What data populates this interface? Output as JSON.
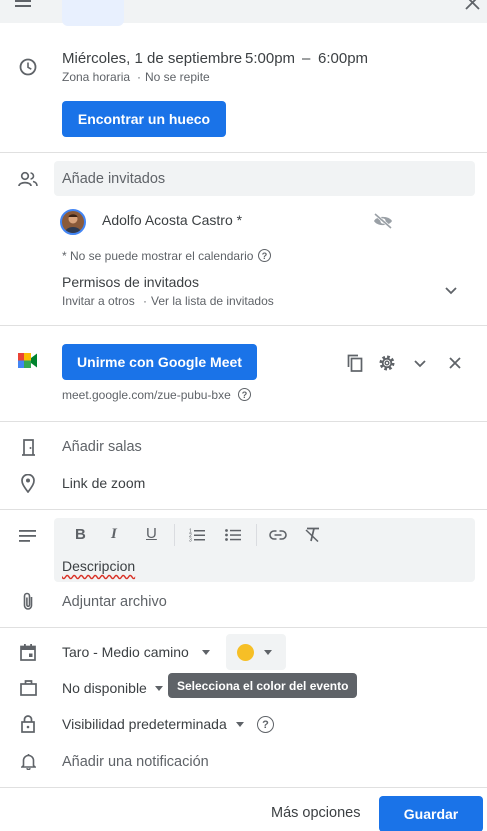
{
  "datetime": {
    "date": "Miércoles, 1 de septiembre",
    "start": "5:00pm",
    "dash": "–",
    "end": "6:00pm",
    "timezone": "Zona horaria",
    "repeat": "No se repite"
  },
  "find_slot_button": "Encontrar un hueco",
  "guests": {
    "input_placeholder": "Añade invitados",
    "guest_name": "Adolfo Acosta Castro *",
    "calendar_note": "* No se puede mostrar el calendario",
    "permissions_title": "Permisos de invitados",
    "permissions_detail_1": "Invitar a otros",
    "permissions_detail_2": "Ver la lista de invitados"
  },
  "meet": {
    "join_button": "Unirme con Google Meet",
    "link": "meet.google.com/zue-pubu-bxe"
  },
  "rooms_label": "Añadir salas",
  "location_value": "Link de zoom",
  "description": {
    "text": "Descripcion"
  },
  "attach_label": "Adjuntar archivo",
  "calendar": {
    "name": "Taro - Medio camino",
    "color": "#f6bf26",
    "color_tooltip": "Selecciona el color del evento"
  },
  "availability": "No disponible",
  "visibility": "Visibilidad predeterminada",
  "notification": "Añadir una notificación",
  "footer": {
    "more_options": "Más opciones",
    "save": "Guardar"
  },
  "colors": {
    "accent": "#1a73e8",
    "field_bg": "#f1f3f4",
    "tooltip_bg": "#5f6368"
  }
}
